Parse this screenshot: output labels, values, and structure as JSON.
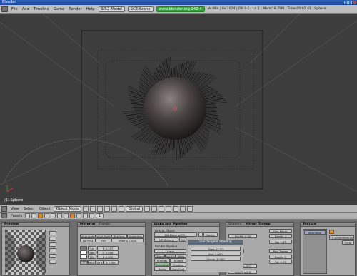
{
  "window": {
    "title": "Blender"
  },
  "menubar": {
    "items": [
      "File",
      "Add",
      "Timeline",
      "Game",
      "Render",
      "Help"
    ],
    "screen_field": "SR:2-Model",
    "scene_field": "SCE:Scene",
    "url": "www.blender.org 242-4",
    "stats": "Ve:984 | Fa:1024 | Ob:3-1 | La:1 | Mem:18.79M | Time:00:02.41 | Sphere"
  },
  "viewport": {
    "object_label": "(1) Sphere"
  },
  "view_header": {
    "items": [
      "View",
      "Select",
      "Object"
    ],
    "mode": "Object Mode",
    "pivot": "Global"
  },
  "buttons_header": {
    "label": "Panels",
    "frame": "1"
  },
  "panels": {
    "preview": {
      "tab": "Preview"
    },
    "material": {
      "tabs": [
        "Material",
        "Ramps"
      ],
      "row1": [
        "VCol Light",
        "VCol Paint",
        "TexFace",
        "Shadeless"
      ],
      "row2": [
        "No Mist",
        "Env",
        "Shad A 1.000"
      ],
      "row3": [
        "R 0.237",
        "G 0.096",
        "B 0.000"
      ],
      "row4": [
        "RGB",
        "HSV",
        "DYN",
        "A 0.000"
      ],
      "col_labels": [
        "Col",
        "Spe",
        "Mir"
      ]
    },
    "links": {
      "tabs": [
        "Links and Pipeline"
      ],
      "link_label": "Link to Object",
      "material_field": "MA:Material.001",
      "nodes_btn": "Nodes",
      "me_field": "ME:Sphere",
      "ob_btn": "OB",
      "pipeline_label": "Render Pipeline",
      "pipe_btns": [
        "Halo",
        "ZTransp",
        "Full Osa",
        "Wire",
        "Strands",
        "ZInvert",
        "Traceable",
        "Shadbuf",
        "Radio",
        "OnlyCast"
      ]
    },
    "popup": {
      "title": "Use Tangent Shading",
      "rows": [
        "Start 12.00",
        "End 1.000",
        "Shape -0.900"
      ]
    },
    "shaders": {
      "tabs": [
        "Shaders",
        "Mirror Transp"
      ],
      "btns": [
        "Ray Mirror",
        "Depth: 2",
        "Fac 1.25",
        "Ray Transp",
        "Depth: 2",
        "Fac 1.25"
      ],
      "ray_mir": "RayMir 0.00",
      "alpha": "0.000",
      "filter": "Filter 0.000",
      "spec_tra": "SpecTra 1.0"
    },
    "texture": {
      "tabs": [
        "Texture"
      ],
      "selected": "strandtex",
      "te_field": "TE:strandtexture",
      "clear_btn": "Clear"
    }
  }
}
